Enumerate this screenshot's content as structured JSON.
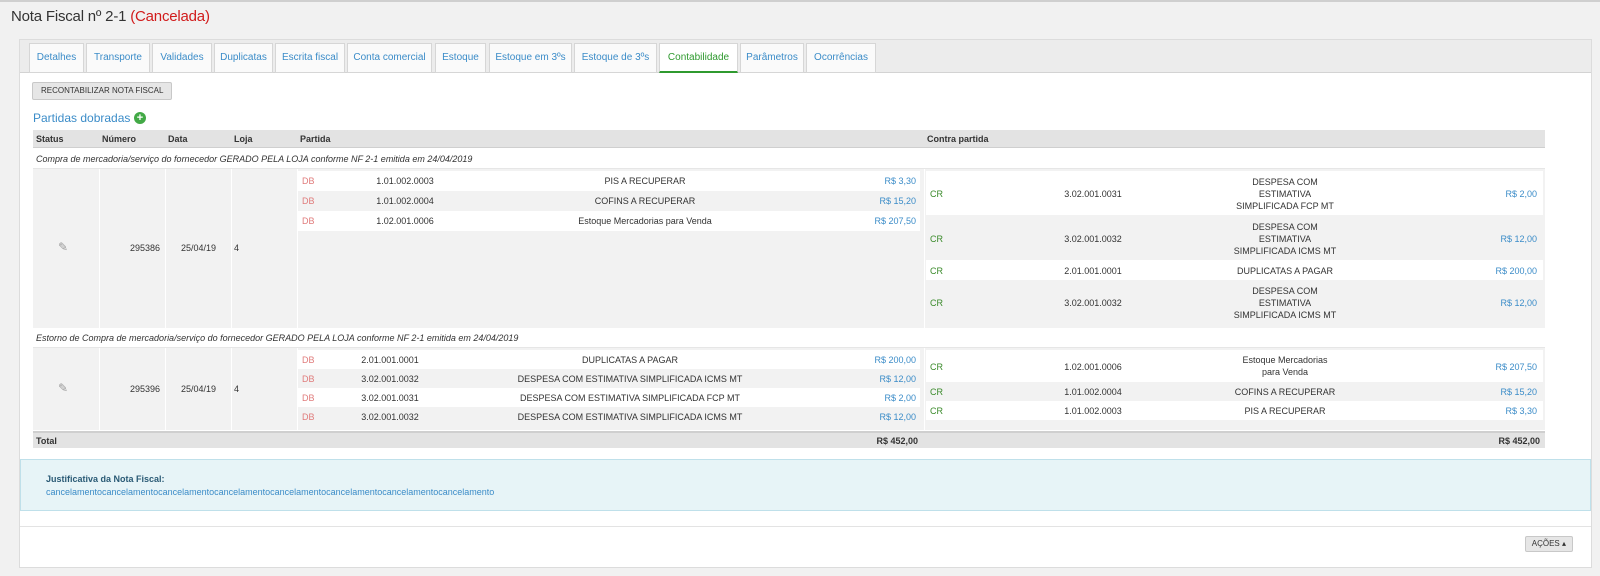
{
  "header": {
    "title": "Nota Fiscal nº 2-1",
    "status": "(Cancelada)"
  },
  "tabs": [
    "Detalhes",
    "Transporte",
    "Validades",
    "Duplicatas",
    "Escrita fiscal",
    "Conta comercial",
    "Estoque",
    "Estoque em 3ºs",
    "Estoque de 3ºs",
    "Contabilidade",
    "Parâmetros",
    "Ocorrências"
  ],
  "active_tab": "Contabilidade",
  "toolbar": {
    "recontabilizar_label": "RECONTABILIZAR NOTA FISCAL"
  },
  "section": {
    "title": "Partidas dobradas"
  },
  "table": {
    "columns": [
      "Status",
      "Número",
      "Data",
      "Loja",
      "Partida",
      "Contra partida"
    ],
    "groups": [
      {
        "description": "Compra de mercadoria/serviço do fornecedor GERADO PELA LOJA conforme NF 2-1 emitida em 24/04/2019",
        "numero": "295386",
        "data": "25/04/19",
        "loja": "4",
        "partida": [
          {
            "tipo": "DB",
            "conta": "1.01.002.0003",
            "descricao": "PIS A RECUPERAR",
            "valor": "R$ 3,30"
          },
          {
            "tipo": "DB",
            "conta": "1.01.002.0004",
            "descricao": "COFINS A RECUPERAR",
            "valor": "R$ 15,20"
          },
          {
            "tipo": "DB",
            "conta": "1.02.001.0006",
            "descricao": "Estoque Mercadorias para Venda",
            "valor": "R$ 207,50"
          }
        ],
        "contrapartida": [
          {
            "tipo": "CR",
            "conta": "3.02.001.0031",
            "descricao": [
              "DESPESA COM",
              "ESTIMATIVA",
              "SIMPLIFICADA FCP MT"
            ],
            "valor": "R$ 2,00"
          },
          {
            "tipo": "CR",
            "conta": "3.02.001.0032",
            "descricao": [
              "DESPESA COM",
              "ESTIMATIVA",
              "SIMPLIFICADA ICMS MT"
            ],
            "valor": "R$ 12,00"
          },
          {
            "tipo": "CR",
            "conta": "2.01.001.0001",
            "descricao": [
              "DUPLICATAS A PAGAR"
            ],
            "valor": "R$ 200,00"
          },
          {
            "tipo": "CR",
            "conta": "3.02.001.0032",
            "descricao": [
              "DESPESA COM",
              "ESTIMATIVA",
              "SIMPLIFICADA ICMS MT"
            ],
            "valor": "R$ 12,00"
          }
        ]
      },
      {
        "description": "Estorno de Compra de mercadoria/serviço do fornecedor GERADO PELA LOJA conforme NF 2-1 emitida em 24/04/2019",
        "numero": "295396",
        "data": "25/04/19",
        "loja": "4",
        "partida": [
          {
            "tipo": "DB",
            "conta": "2.01.001.0001",
            "descricao": "DUPLICATAS A PAGAR",
            "valor": "R$ 200,00"
          },
          {
            "tipo": "DB",
            "conta": "3.02.001.0032",
            "descricao": "DESPESA COM ESTIMATIVA SIMPLIFICADA ICMS MT",
            "valor": "R$ 12,00"
          },
          {
            "tipo": "DB",
            "conta": "3.02.001.0031",
            "descricao": "DESPESA COM ESTIMATIVA SIMPLIFICADA FCP MT",
            "valor": "R$ 2,00"
          },
          {
            "tipo": "DB",
            "conta": "3.02.001.0032",
            "descricao": "DESPESA COM ESTIMATIVA SIMPLIFICADA ICMS MT",
            "valor": "R$ 12,00"
          }
        ],
        "contrapartida": [
          {
            "tipo": "CR",
            "conta": "1.02.001.0006",
            "descricao": [
              "Estoque Mercadorias",
              "para Venda"
            ],
            "valor": "R$ 207,50"
          },
          {
            "tipo": "CR",
            "conta": "1.01.002.0004",
            "descricao": [
              "COFINS A RECUPERAR"
            ],
            "valor": "R$ 15,20"
          },
          {
            "tipo": "CR",
            "conta": "1.01.002.0003",
            "descricao": [
              "PIS A RECUPERAR"
            ],
            "valor": "R$ 3,30"
          }
        ]
      }
    ],
    "total": {
      "label": "Total",
      "partida": "R$ 452,00",
      "contrapartida": "R$ 452,00"
    }
  },
  "justificativa": {
    "title": "Justificativa da Nota Fiscal:",
    "text": "cancelamentocancelamentocancelamentocancelamentocancelamentocancelamentocancelamentocancelamento"
  },
  "footer": {
    "actions_label": "AÇÕES ▴"
  },
  "colors": {
    "accent": "#3b8cc8",
    "active_tab": "#2f9a2f",
    "status_cancel": "#d11b1b",
    "debit": "#e07b7b",
    "credit": "#3a8a2a"
  },
  "icons": {
    "status": "pencil-icon",
    "add": "plus-circle-icon"
  }
}
